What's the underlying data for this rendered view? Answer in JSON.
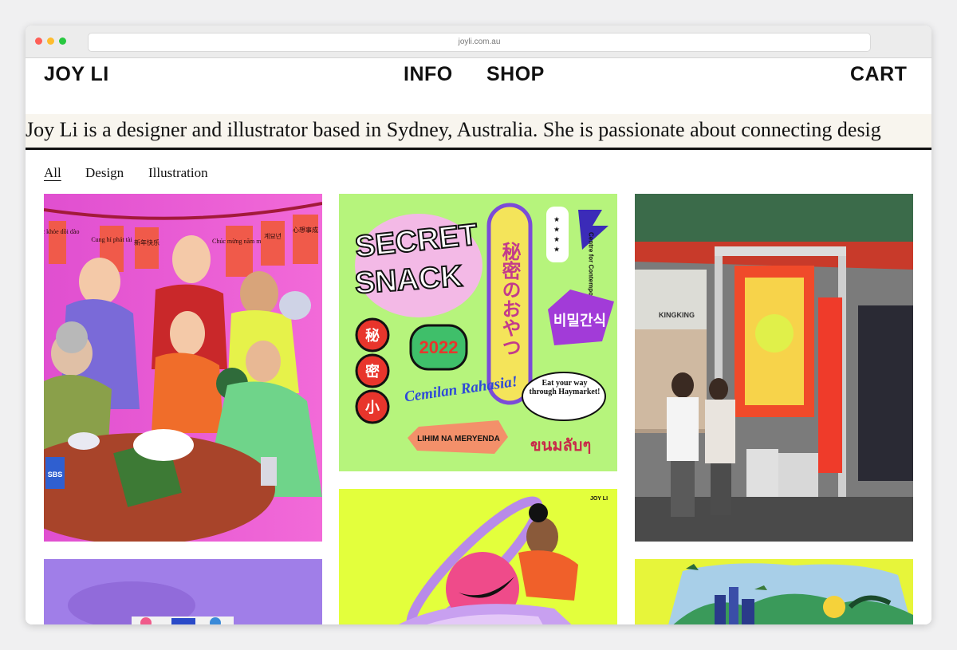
{
  "browser": {
    "url": "joyli.com.au"
  },
  "nav": {
    "logo": "JOY LI",
    "info": "INFO",
    "shop": "SHOP",
    "cart": "CART"
  },
  "banner": {
    "text": "Joy Li is a designer and illustrator based in Sydney, Australia. She is passionate about connecting desig"
  },
  "filters": [
    {
      "label": "All"
    },
    {
      "label": "Design"
    },
    {
      "label": "Illustration"
    }
  ],
  "artwork": {
    "lantern_texts": [
      "Sắc khỏe dồi dào",
      "Cung hỉ phát tài",
      "新年快乐",
      "Chúc mừng năm mới",
      "계묘년",
      "心想事成"
    ],
    "can_label": "SBS",
    "secret_snack": {
      "title_line1": "SECRET",
      "title_line2": "SNACK",
      "vertical_jp": "秘密のおやつ",
      "org": "Centre for Contemporary Asian Art",
      "stars": "★ ★ ★ ★",
      "korean": "비밀간식",
      "year": "2022",
      "chinese": [
        "秘",
        "密",
        "小"
      ],
      "malay": "Cemilan Rahasia!",
      "bubble": "Eat your way through Haymarket!",
      "filipino": "LIHIM NA MERYENDA",
      "thai": "ขนมลับๆ"
    },
    "sign_text": "KINGKING",
    "joy_li_mark": "JOY LI"
  },
  "colors": {
    "ink": "#111111",
    "banner_bg": "#f8f5ee",
    "snack_green": "#b6f47c",
    "poster_lime": "#e3ff3c",
    "street_red": "#e8352c",
    "lilac": "#a07ee8"
  }
}
